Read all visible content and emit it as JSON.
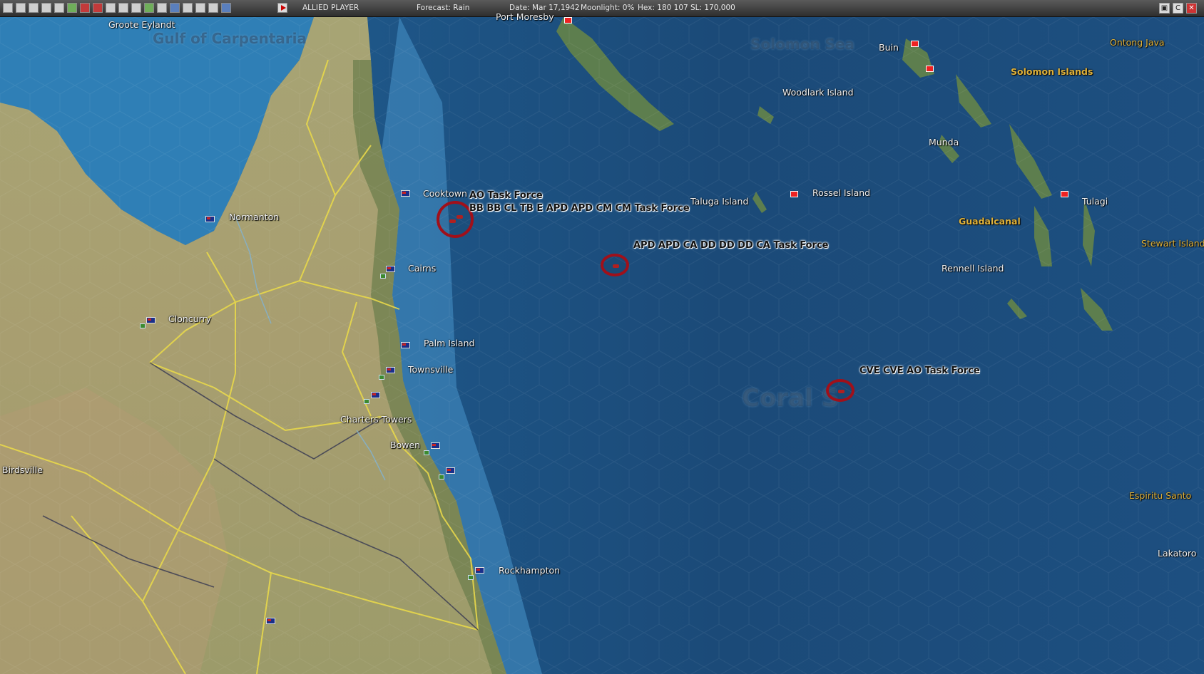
{
  "toolbar": {
    "player": "ALLIED PLAYER",
    "forecast": "Forecast: Rain",
    "date": "Date: Mar 17,1942",
    "moonlight": "Moonlight: 0%",
    "hex": "Hex: 180 107  SL: 170,000",
    "buttons": [
      "toolbar-button-1",
      "toolbar-button-2",
      "toolbar-button-3",
      "toolbar-button-4",
      "toolbar-button-5",
      "toolbar-button-6",
      "toolbar-button-7",
      "toolbar-button-8",
      "toolbar-button-9",
      "toolbar-button-10",
      "toolbar-button-11",
      "toolbar-button-12",
      "toolbar-button-13",
      "toolbar-button-14",
      "toolbar-button-15",
      "toolbar-button-16",
      "toolbar-button-17",
      "toolbar-button-18"
    ],
    "window_controls": [
      "map-icon",
      "close-map-icon",
      "close-icon"
    ]
  },
  "map": {
    "sea_names": {
      "gulf": "Gulf of Carpentaria",
      "solomon_sea": "Solomon Sea",
      "coral_sea": "Coral S"
    },
    "places": [
      "Groote Eylandt",
      "Port Moresby",
      "Buin",
      "Ontong Java",
      "Solomon Islands",
      "Woodlark Island",
      "Munda",
      "Cooktown",
      "Normanton",
      "Taluga Island",
      "Rossel Island",
      "Tulagi",
      "Guadalcanal",
      "Stewart Island",
      "Cairns",
      "Rennell Island",
      "Cloncurry",
      "Palm Island",
      "Townsville",
      "Charters Towers",
      "Bowen",
      "Birdsville",
      "Espiritu Santo",
      "Lakatoro",
      "Rockhampton"
    ],
    "task_forces": {
      "ao": "AO Task Force",
      "bb": "BB BB CL TB E APD APD CM CM Task Force",
      "apd": "APD APD CA DD DD DD CA Task Force",
      "cve": "CVE CVE AO Task Force"
    },
    "colors": {
      "ocean_deep": "#1b4a78",
      "ocean_shallow": "#4a90c0",
      "land": "#9a9a68",
      "road": "#e8d84a",
      "task_force_ring": "#a0101a",
      "label_gold": "#e0b23a"
    }
  }
}
